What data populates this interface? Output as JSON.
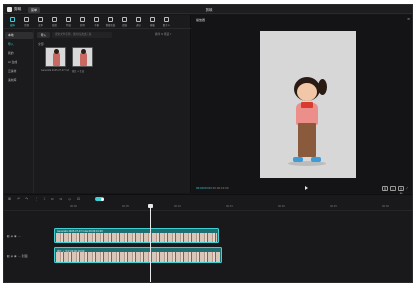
{
  "app": {
    "name": "剪映",
    "menu_label": "菜单",
    "window_title": "剪映"
  },
  "toolbar": {
    "items": [
      {
        "label": "媒体",
        "icon": "media-icon",
        "active": true
      },
      {
        "label": "音频",
        "icon": "audio-icon",
        "active": false
      },
      {
        "label": "文本",
        "icon": "text-icon",
        "active": false
      },
      {
        "label": "贴纸",
        "icon": "sticker-icon",
        "active": false
      },
      {
        "label": "特效",
        "icon": "effects-icon",
        "active": false
      },
      {
        "label": "转场",
        "icon": "transition-icon",
        "active": false
      },
      {
        "label": "字幕",
        "icon": "caption-icon",
        "active": false
      },
      {
        "label": "智能包装",
        "icon": "smart-pack-icon",
        "active": false
      },
      {
        "label": "滤镜",
        "icon": "filter-icon",
        "active": false
      },
      {
        "label": "调节",
        "icon": "adjust-icon",
        "active": false
      },
      {
        "label": "模板",
        "icon": "template-icon",
        "active": false
      },
      {
        "label": "数字人",
        "icon": "avatar-icon",
        "active": false
      }
    ]
  },
  "sidebar": {
    "items": [
      {
        "label": "本地",
        "selected": true,
        "accent": false
      },
      {
        "label": "导入",
        "selected": false,
        "accent": true
      },
      {
        "label": "我的",
        "selected": false,
        "accent": false
      },
      {
        "label": "AI 生成",
        "selected": false,
        "accent": false
      },
      {
        "label": "云素材",
        "selected": false,
        "accent": false
      },
      {
        "label": "素材库",
        "selected": false,
        "accent": false
      }
    ]
  },
  "media": {
    "import_label": "导入",
    "search_placeholder": "搜索文件名称、图片描述或元素",
    "sort_label": "排序 ⇅  筛选 ▿",
    "section_label": "全部",
    "thumbs": [
      {
        "caption": "Generate 2025-07-07 Cute"
      },
      {
        "caption": "微信 + 生成"
      }
    ]
  },
  "player": {
    "title": "播放器",
    "menu": "≡",
    "current_time": "00:00:03:03",
    "total_time": "00:00:10:00",
    "controls": [
      "原",
      "⛶",
      "比例",
      "⤢"
    ]
  },
  "timeline": {
    "ruler": [
      "00:00",
      "00:05",
      "00:10",
      "00:15",
      "00:20",
      "00:25",
      "00:30"
    ],
    "tracks": [
      {
        "header": "◧ ◈ ◉ ⋯",
        "clip_label": "Generate 2025-07-07 Cute 00:00:10:00"
      },
      {
        "header": "◧ ◈ ◉ ⋯  封面",
        "clip_label": "微信 + 生成  00:00:10:00"
      }
    ],
    "tools": [
      "⊞",
      "↶",
      "↷",
      "⋮",
      "⌶",
      "⊏",
      "⊐",
      "◇",
      "⊡"
    ]
  },
  "colors": {
    "accent": "#3fd0d4",
    "clip": "#1e6f72",
    "panel": "#1b1b1d"
  }
}
